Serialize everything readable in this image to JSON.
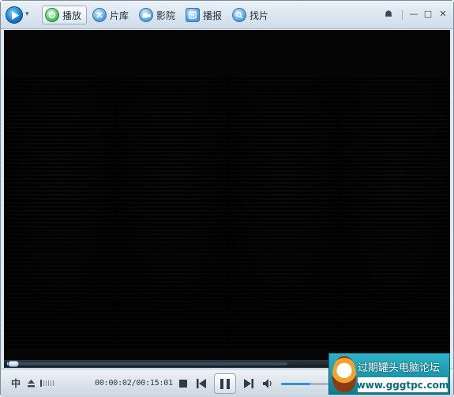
{
  "app": {
    "logo_icon": "play-logo-icon",
    "menu_arrow": "▾"
  },
  "nav": {
    "items": [
      {
        "label": "播放",
        "icon": "play-nav-icon",
        "active": true
      },
      {
        "label": "片库",
        "icon": "library-nav-icon",
        "active": false
      },
      {
        "label": "影院",
        "icon": "camera-nav-icon",
        "active": false
      },
      {
        "label": "播报",
        "icon": "news-nav-icon",
        "active": false
      },
      {
        "label": "找片",
        "icon": "search-nav-icon",
        "active": false
      }
    ]
  },
  "window_controls": {
    "skin": "☗",
    "minimize": "—",
    "maximize": "□",
    "close": "✕"
  },
  "player": {
    "progress_fraction": 0.004,
    "time_display": "00:00:02/00:15:01",
    "volume_fraction": 0.6,
    "lang_label": "中",
    "colors": {
      "accent": "#3b91d0",
      "window": "#dfe8f0"
    }
  },
  "watermark": {
    "text": "过期罐头电脑论坛",
    "url": "www.gggtpc.com"
  }
}
